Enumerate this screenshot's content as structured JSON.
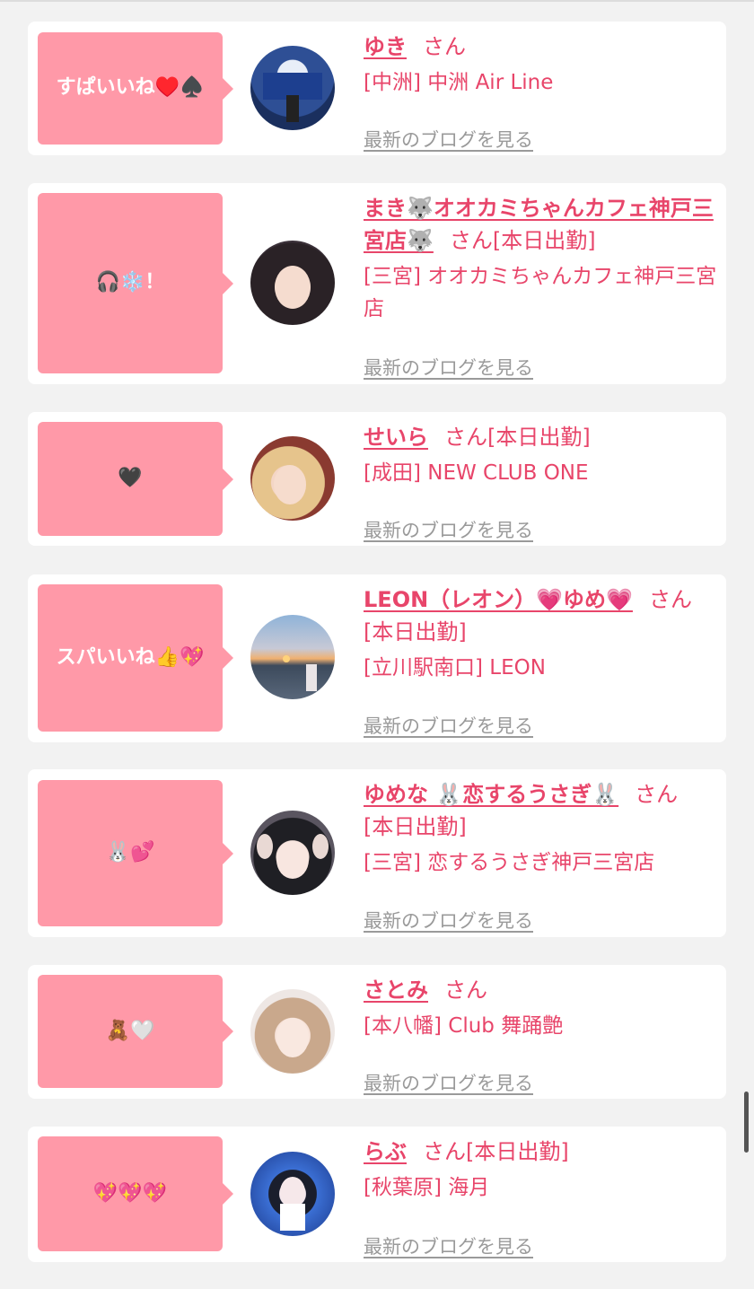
{
  "san_suffix": "さん",
  "blog_link_label": "最新のブログを見る",
  "colors": {
    "accent": "#e8456a",
    "bubble": "#ff99a8",
    "background": "#f2f2f2"
  },
  "entries": [
    {
      "comment": "すぱいいね♥️♠️",
      "name": "ゆき",
      "status": "",
      "shop": "[中洲] 中洲 Air Line"
    },
    {
      "comment": "🎧❄️！",
      "name": "まき🐺オオカミちゃんカフェ神戸三宮店🐺",
      "status": "[本日出勤]",
      "shop": "[三宮] オオカミちゃんカフェ神戸三宮店"
    },
    {
      "comment": "🖤",
      "name": "せいら",
      "status": "[本日出勤]",
      "shop": "[成田] NEW CLUB ONE"
    },
    {
      "comment": "スパいいね👍💖",
      "name": "LEON（レオン）💗ゆめ💗",
      "status": "[本日出勤]",
      "shop": "[立川駅南口] LEON"
    },
    {
      "comment": "🐰💕",
      "name": "ゆめな 🐰恋するうさぎ🐰",
      "status": "[本日出勤]",
      "shop": "[三宮] 恋するうさぎ神戸三宮店"
    },
    {
      "comment": "🧸🤍",
      "name": "さとみ",
      "status": "",
      "shop": "[本八幡] Club 舞踊艶"
    },
    {
      "comment": "💖💖💖",
      "name": "らぶ",
      "status": "[本日出勤]",
      "shop": "[秋葉原] 海月"
    }
  ]
}
